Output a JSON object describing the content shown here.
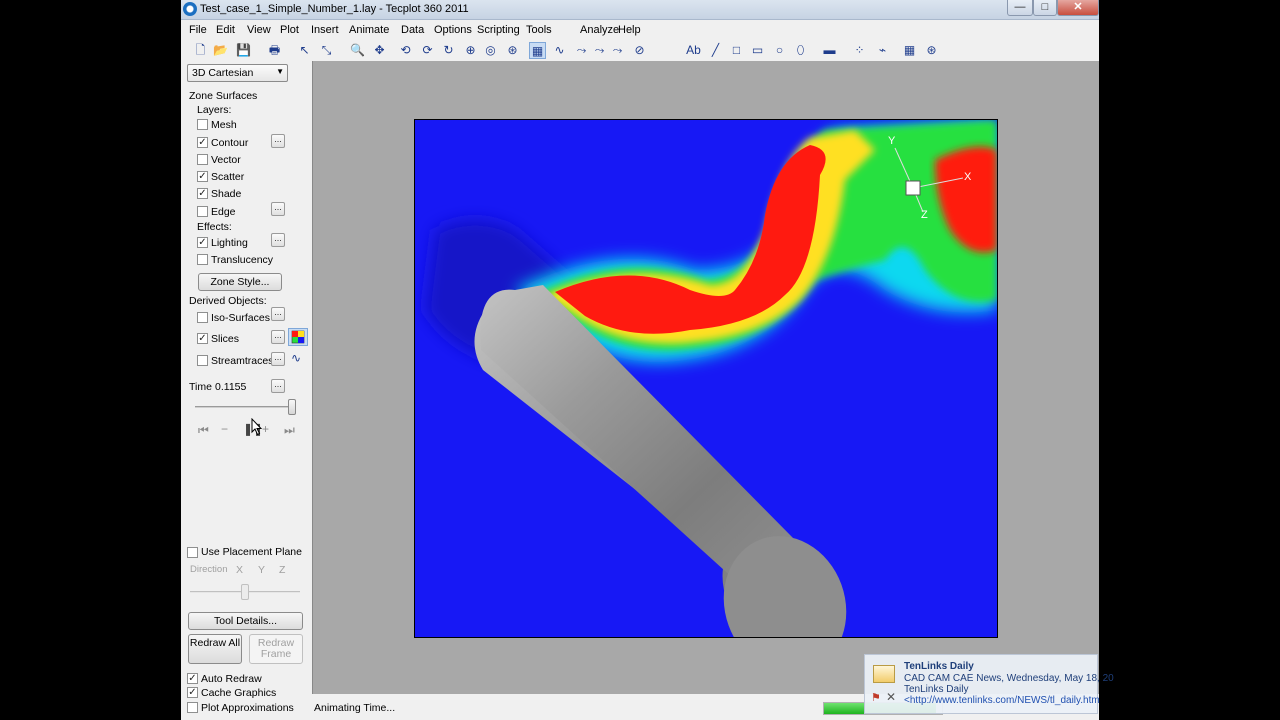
{
  "window": {
    "title": "Test_case_1_Simple_Number_1.lay - Tecplot 360 2011",
    "minimize": "—",
    "maximize": "□",
    "close": "✕"
  },
  "menu": [
    "File",
    "Edit",
    "View",
    "Plot",
    "Insert",
    "Animate",
    "Data",
    "Options",
    "Scripting",
    "Tools",
    "Analyze",
    "Help"
  ],
  "toolbar": {
    "icons": [
      "new-file-icon",
      "open-file-icon",
      "save-icon",
      "print-icon",
      "select-arrow-icon",
      "adjustor-icon",
      "zoom-icon",
      "translate-icon",
      "rotate-x-icon",
      "rotate-y-icon",
      "rotate-z-icon",
      "rotate-spherical-icon",
      "rotate-rollerball-icon",
      "probe-icon",
      "slice-tool-icon",
      "streamtrace-icon",
      "contour-line-icon",
      "contour-add-icon",
      "contour-remove-icon",
      "extract-icon",
      "text-icon",
      "line-icon",
      "rectangle-icon",
      "square-icon",
      "circle-icon",
      "ellipse-icon",
      "frame-icon",
      "polyline-points-icon",
      "polyline-connected-icon",
      "grid-icon",
      "polar-grid-icon"
    ],
    "glyphs": [
      "🗋",
      "📂",
      "💾",
      "🖶",
      "↖",
      "⤡",
      "🔍",
      "✥",
      "⟲",
      "⟳",
      "↻",
      "⊕",
      "◎",
      "⊛",
      "▦",
      "∿",
      "⤳",
      "⤳",
      "⤳",
      "⊘",
      "Ab",
      "╱",
      "□",
      "▭",
      "○",
      "⬯",
      "▬",
      "⁘",
      "⌁",
      "▦",
      "⊛"
    ]
  },
  "sidebar": {
    "plot_type": "3D Cartesian",
    "zone_surfaces": "Zone Surfaces",
    "layers_label": "Layers:",
    "layers": [
      {
        "label": "Mesh",
        "checked": false
      },
      {
        "label": "Contour",
        "checked": true
      },
      {
        "label": "Vector",
        "checked": false
      },
      {
        "label": "Scatter",
        "checked": true
      },
      {
        "label": "Shade",
        "checked": true
      },
      {
        "label": "Edge",
        "checked": false
      }
    ],
    "effects_label": "Effects:",
    "effects": [
      {
        "label": "Lighting",
        "checked": true
      },
      {
        "label": "Translucency",
        "checked": false
      }
    ],
    "zone_style_button": "Zone Style...",
    "derived_label": "Derived Objects:",
    "derived": [
      {
        "label": "Iso-Surfaces",
        "checked": false
      },
      {
        "label": "Slices",
        "checked": true
      },
      {
        "label": "Streamtraces",
        "checked": false
      }
    ],
    "dots": "...",
    "time_label": "Time",
    "time_value": "0.1155",
    "time_position": 0.97,
    "placement_plane": {
      "label": "Use Placement Plane",
      "checked": false
    },
    "direction_label": "Direction",
    "direction_axes": [
      "X",
      "Y",
      "Z"
    ],
    "tool_details_button": "Tool Details...",
    "redraw_all_button": "Redraw All",
    "redraw_frame_button": "Redraw Frame",
    "options": [
      {
        "label": "Auto Redraw",
        "checked": true
      },
      {
        "label": "Cache Graphics",
        "checked": true
      },
      {
        "label": "Plot Approximations",
        "checked": false
      }
    ],
    "check_mark": "✓"
  },
  "plot": {
    "axes": {
      "x": "X",
      "y": "Y",
      "z": "Z"
    },
    "colors": {
      "background": "#1718f5",
      "cylinder": "#8a8a8a",
      "hot": "#ff1a10",
      "warm": "#ffe020",
      "mid": "#28e040",
      "cool": "#10d8f0"
    }
  },
  "status": {
    "text": "Animating Time...",
    "progress": 0.95
  },
  "notification": {
    "title": "TenLinks Daily",
    "line1": "CAD CAM CAE News, Wednesday, May 18, 20",
    "line2": "TenLinks Daily",
    "line3": "<http://www.tenlinks.com/NEWS/tl_daily.htm"
  }
}
